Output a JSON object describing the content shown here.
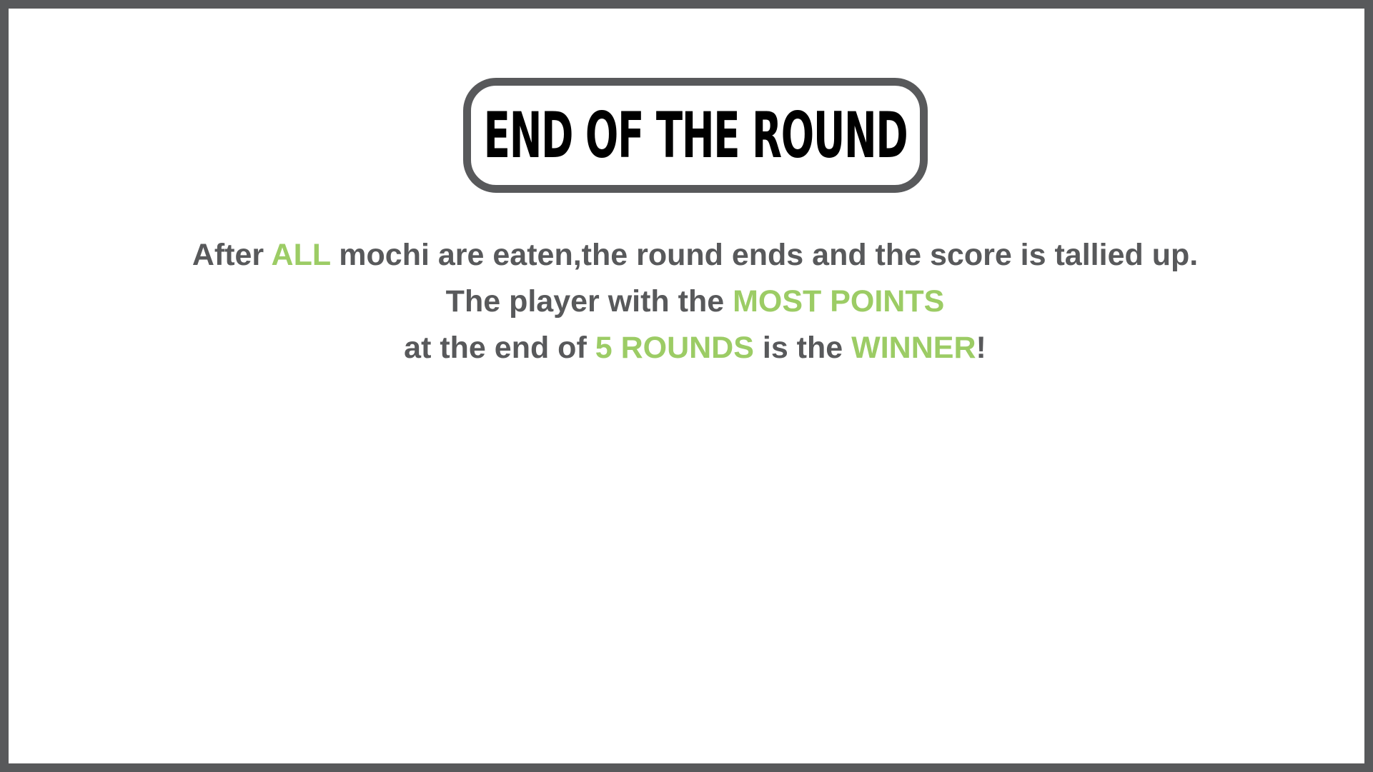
{
  "title": "END OF THE ROUND",
  "colors": {
    "border": "#58595b",
    "text": "#58595b",
    "highlight": "#9ccc65",
    "title_text": "#000000",
    "background": "#ffffff"
  },
  "rules": {
    "line1": {
      "a": "After ",
      "b": "ALL",
      "c": " mochi are eaten,the round ends and the score is tallied up."
    },
    "line2": {
      "a": "The player with the ",
      "b": "MOST POINTS"
    },
    "line3": {
      "a": "at the end of ",
      "b": "5 ROUNDS",
      "c": " is the ",
      "d": "WINNER",
      "e": "!"
    }
  }
}
